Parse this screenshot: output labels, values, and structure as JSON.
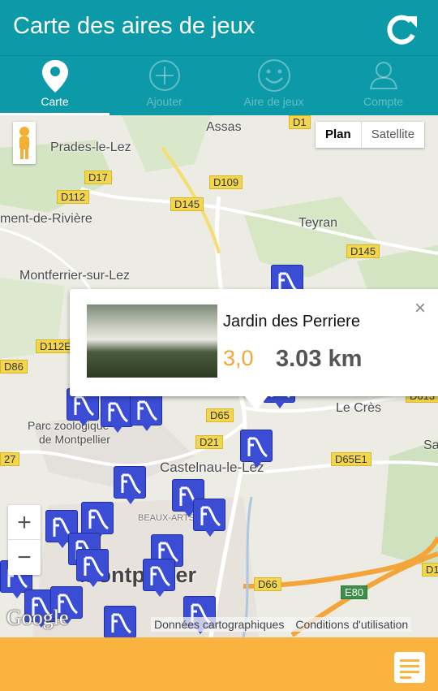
{
  "header": {
    "title": "Carte des aires de jeux",
    "refresh_icon": "refresh-icon"
  },
  "tabs": [
    {
      "label": "Carte",
      "icon": "map-pin-icon",
      "active": true
    },
    {
      "label": "Ajouter",
      "icon": "add-circle-icon",
      "active": false
    },
    {
      "label": "Aire de jeux",
      "icon": "smiley-icon",
      "active": false
    },
    {
      "label": "Compte",
      "icon": "user-icon",
      "active": false
    }
  ],
  "map": {
    "type_control": {
      "plan": "Plan",
      "satellite": "Satellite",
      "selected": "Plan"
    },
    "places": {
      "assas": "Assas",
      "prades": "Prades-le-Lez",
      "riviere": "ment-de-Rivière",
      "teyran": "Teyran",
      "montferrier": "Montferrier-sur-Lez",
      "cres": "Le Crès",
      "parc": "Parc zoologique",
      "parc2": "de Montpellier",
      "castelnau": "Castelnau-le-Lez",
      "beaux_arts": "BEAUX-ARTS",
      "montpellier": "Montpellier",
      "sa": "Sa"
    },
    "roads": {
      "d17": "D17",
      "d112": "D112",
      "d109": "D109",
      "d145a": "D145",
      "d145b": "D145",
      "d112e": "D112E",
      "d86": "D86",
      "d65": "D65",
      "d21": "D21",
      "d65e1": "D65E1",
      "d66": "D66",
      "e80": "E80",
      "d27": "27",
      "d1": "D1",
      "d613": "D613",
      "d1top": "D1"
    },
    "zoom_in": "+",
    "zoom_out": "−",
    "attribution": {
      "data": "Données cartographiques",
      "terms": "Conditions d'utilisation"
    },
    "google": "Google"
  },
  "popup": {
    "title": "Jardin des Perriere",
    "rating": "3,0",
    "distance": "3.03 km",
    "close": "×"
  },
  "colors": {
    "header": "#0d9aa8",
    "footer": "#fbb33f",
    "marker": "#3a4dd4",
    "rating": "#f2a63a"
  },
  "footer": {
    "list_icon": "list-icon"
  }
}
